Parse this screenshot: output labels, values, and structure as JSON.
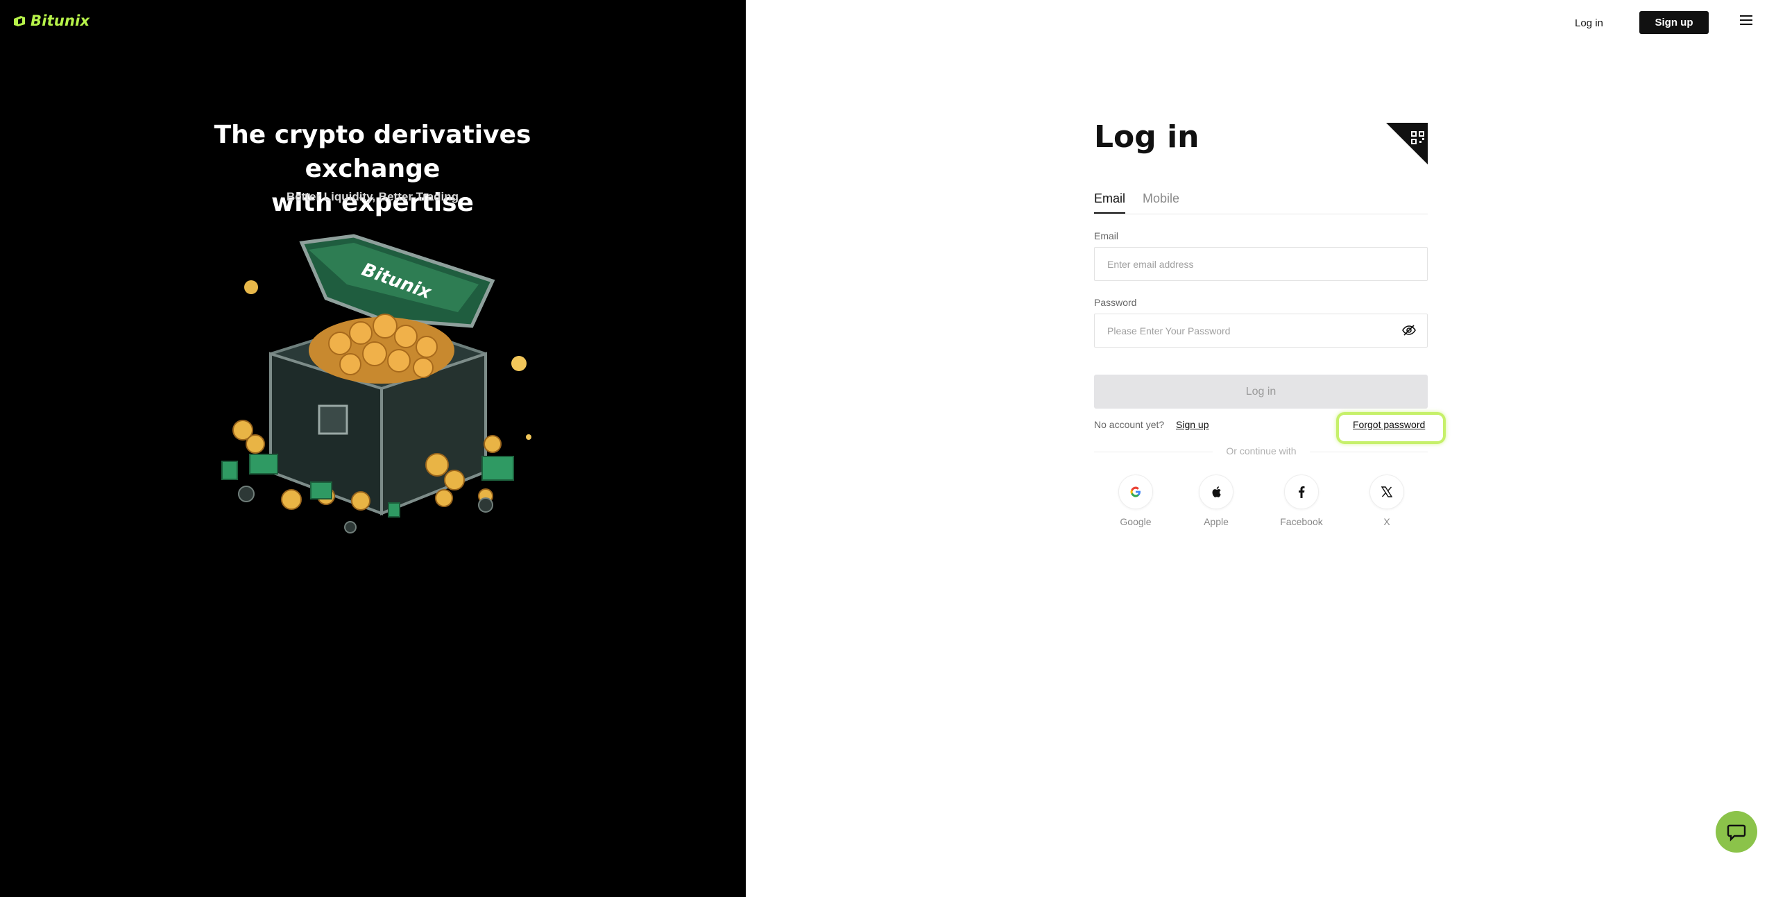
{
  "brand": {
    "name": "Bitunix",
    "accent": "#b7f34a"
  },
  "hero": {
    "title_line1": "The crypto derivatives exchange",
    "title_line2": "with expertise",
    "subtitle": "Better Liquidity, Better Trading",
    "chest_label": "Bitunix"
  },
  "header": {
    "login_label": "Log in",
    "signup_label": "Sign up"
  },
  "form": {
    "title": "Log in",
    "tabs": [
      {
        "label": "Email",
        "active": true
      },
      {
        "label": "Mobile",
        "active": false
      }
    ],
    "email_label": "Email",
    "email_placeholder": "Enter email address",
    "password_label": "Password",
    "password_placeholder": "Please Enter Your Password",
    "submit_label": "Log in",
    "no_account": "No account yet?",
    "signup_link": "Sign up",
    "forgot_link": "Forgot password",
    "or_continue": "Or continue with",
    "socials": [
      {
        "label": "Google",
        "icon": "google-icon"
      },
      {
        "label": "Apple",
        "icon": "apple-icon"
      },
      {
        "label": "Facebook",
        "icon": "facebook-icon"
      },
      {
        "label": "X",
        "icon": "x-icon"
      }
    ]
  },
  "colors": {
    "highlight": "#c6f06a",
    "chat": "#8bc34a"
  }
}
